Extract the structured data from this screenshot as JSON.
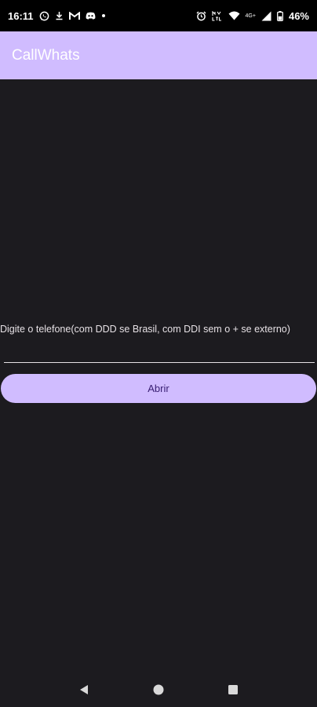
{
  "status_bar": {
    "time": "16:11",
    "network_label": "4G+",
    "battery_percent": "46%",
    "left_icons": [
      "whatsapp-icon",
      "download-icon",
      "gmail-icon",
      "discord-icon",
      "dot-icon"
    ],
    "right_icons": [
      "alarm-icon",
      "volte-icon",
      "wifi-icon",
      "signal-icon",
      "battery-icon"
    ]
  },
  "app_bar": {
    "title": "CallWhats",
    "color": "#d0bcff"
  },
  "form": {
    "label": "Digite o telefone(com DDD se Brasil, com DDI sem o + se externo)",
    "phone_value": "",
    "button_label": "Abrir"
  },
  "nav_bar": {
    "icons": [
      "back-icon",
      "home-icon",
      "recents-icon"
    ]
  },
  "colors": {
    "background": "#1c1b1f",
    "accent": "#d0bcff",
    "button_text": "#381e72",
    "text": "#e6e1e5"
  }
}
